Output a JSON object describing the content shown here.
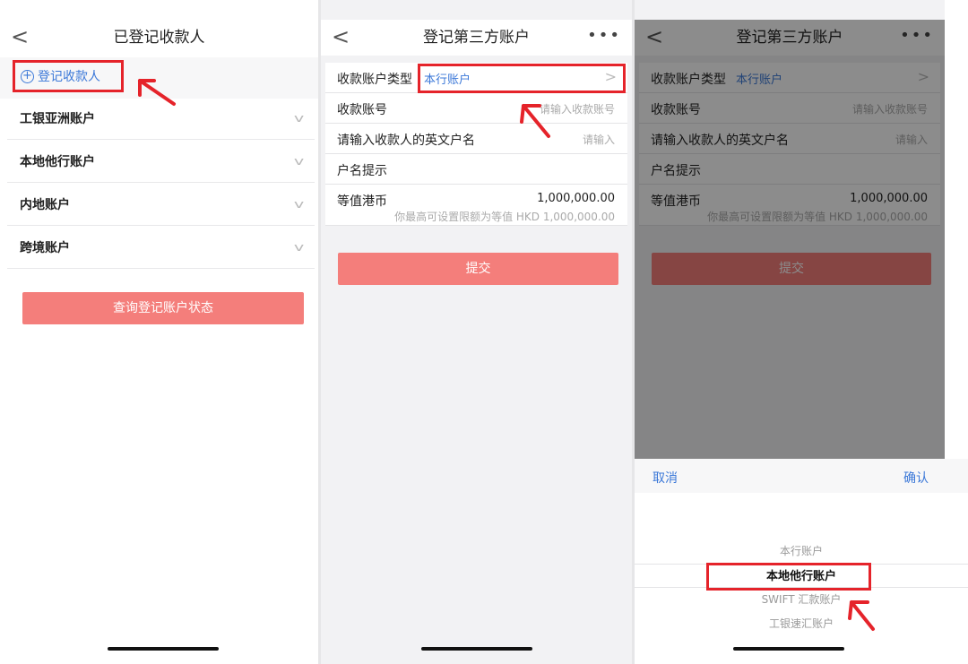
{
  "screen1": {
    "back_label": "<",
    "title": "已登记收款人",
    "add_label": "登记收款人",
    "add_icon": "plus-circle-icon",
    "accounts": [
      {
        "label": "工银亚洲账户"
      },
      {
        "label": "本地他行账户"
      },
      {
        "label": "内地账户"
      },
      {
        "label": "跨境账户"
      }
    ],
    "query_button": "查询登记账户状态"
  },
  "screen2": {
    "back_label": "<",
    "title": "登记第三方账户",
    "more_label": "•••",
    "fields": {
      "account_type_label": "收款账户类型",
      "account_type_value": "本行账户",
      "account_no_label": "收款账号",
      "account_no_placeholder": "请输入收款账号",
      "name_label": "请输入收款人的英文户名",
      "name_placeholder": "请输入",
      "hint_label": "户名提示",
      "limit_label": "等值港币",
      "limit_value": "1,000,000.00",
      "limit_hint": "你最高可设置限额为等值 HKD 1,000,000.00"
    },
    "submit": "提交"
  },
  "screen3": {
    "back_label": "<",
    "title": "登记第三方账户",
    "more_label": "•••",
    "fields": {
      "account_type_label": "收款账户类型",
      "account_type_value": "本行账户",
      "account_no_label": "收款账号",
      "account_no_placeholder": "请输入收款账号",
      "name_label": "请输入收款人的英文户名",
      "name_placeholder": "请输入",
      "hint_label": "户名提示",
      "limit_label": "等值港币",
      "limit_value": "1,000,000.00",
      "limit_hint": "你最高可设置限额为等值 HKD 1,000,000.00"
    },
    "submit": "提交",
    "picker": {
      "cancel": "取消",
      "confirm": "确认",
      "options": [
        {
          "label": "本行账户"
        },
        {
          "label": "本地他行账户"
        },
        {
          "label": "SWIFT 汇款账户"
        },
        {
          "label": "工银速汇账户"
        }
      ],
      "selected_index": 1
    }
  },
  "colors": {
    "accent_blue": "#3b78d8",
    "button_red": "#f47e7b",
    "highlight_red": "#e5232a"
  }
}
